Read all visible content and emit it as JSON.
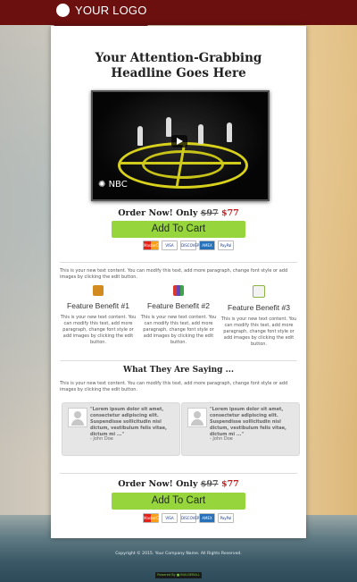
{
  "header": {
    "logo_text": "YOUR LOGO"
  },
  "hero": {
    "headline_line1": "Your Attention-Grabbing",
    "headline_line2": "Headline Goes Here",
    "video_logo": "NBC"
  },
  "offer": {
    "label": "Order Now! Only",
    "old_price": "$97",
    "new_price": "$77",
    "button_label": "Add To Cart",
    "cards": [
      "MasterCard",
      "VISA",
      "DISCOVER",
      "AMEX",
      "PayPal"
    ]
  },
  "intro_text": "This is your new text content. You can modify this text, add more paragraph, change font style or add images by clicking the edit button.",
  "features": [
    {
      "title": "Feature Benefit #1",
      "icon": "stacked-layers-icon",
      "color": "#d38a1e",
      "text": "This is your new text content. You can modify this text, add more paragraph, change font style or add images by clicking the edit button."
    },
    {
      "title": "Feature Benefit #2",
      "icon": "bar-chart-icon",
      "color": "#6a43b8",
      "text": "This is your new text content. You can modify this text, add more paragraph, change font style or add images by clicking the edit button."
    },
    {
      "title": "Feature Benefit #3",
      "icon": "document-icon",
      "color": "#8bb546",
      "text": "This is your new text content. You can modify this text, add more paragraph, change font style or add images by clicking the edit button."
    }
  ],
  "testimonials_section": {
    "title": "What They Are Saying ...",
    "intro": "This is your new text content. You can modify this text, add more paragraph, change font style or add images by clicking the edit button.",
    "items": [
      {
        "quote": "\"Lorem ipsum dolor sit amet, consectetur adipiscing elit. Suspendisse sollicitudin nisl dictum, vestibulum felis vitae, dictum mi ...\"",
        "author": "- John Doe"
      },
      {
        "quote": "\"Lorem ipsum dolor sit amet, consectetur adipiscing elit. Suspendisse sollicitudin nisl dictum, vestibulum felis vitae, dictum mi ...\"",
        "author": "- John Doe"
      }
    ]
  },
  "footer": {
    "copyright": "Copyright © 2015. Your Company Name. All Rights Reserved.",
    "powered_by": "Powered By ■ BUILDERALL"
  },
  "colors": {
    "brand": "#6b0f0f",
    "button": "#96d63c",
    "price": "#c0191b"
  }
}
